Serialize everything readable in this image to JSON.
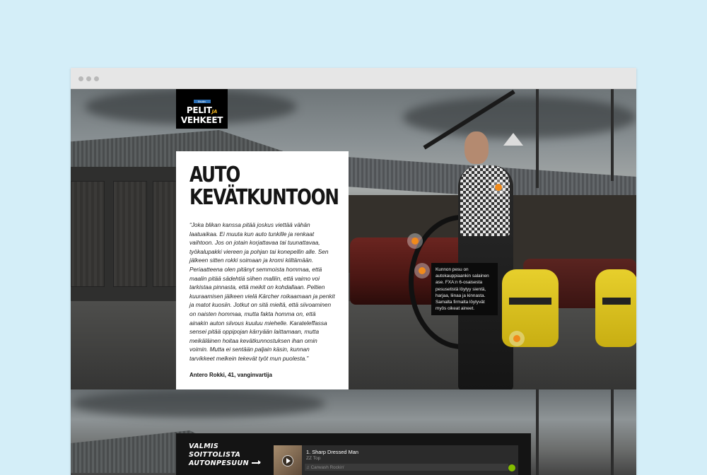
{
  "logo": {
    "badge": "fixutin",
    "line1": "PELIT",
    "line1_small": "JA",
    "line2": "VEHKEET"
  },
  "article": {
    "title_line1": "AUTO",
    "title_line2": "KEVÄTKUNTOON",
    "quote": "“Joka blikan kanssa pitää joskus viettää vähän laatuaikaa. Ei muuta kun auto tunkille ja renkaat vaihtoon. Jos on jotain korjattavaa tai tuunattavaa, työkalupakki viereen ja pohjan tai konepellin alle. Sen jälkeen sitten rokki soimaan ja kromi kiiltämään. Periaatteena olen pitänyt semmoista hommaa, että maalin pitää sädehtiä siihen malliin, että vaimo voi tarkistaa pinnasta, että meikit on kohdallaan. Peltien kuuraamisen jälkeen vielä Kärcher roikaamaan ja penkit ja matot kuosiin. Jotkut on sitä mieltä, että siivoaminen on naisten hommaa, mutta fakta homma on, että ainakin auton siivous kuuluu miehelle. Karateleffassa sensei pitää oppipojan kärryään laittamaan, mutta meikäläinen hoitaa kevätkunnostuksen ihan omin voimin. Mutta ei sentään paljain käsin, kunnan tarvikkeet melkein tekevät työt mun puolesta.”",
    "author": "Antero Rokki, 41, vanginvartija"
  },
  "tooltip": {
    "text": "Kunnon pesu on autokauppiaankin salainen ase. FXA:n 6-osaisesta pesusetistä löytyy sientä, harjaa, liinaa ja kinnasta. Samalta firmalta löytyvät myös oikeat aineet."
  },
  "playlist": {
    "title_line1": "VALMIS",
    "title_line2": "SOITTOLISTA",
    "title_line3": "AUTONPESUUN",
    "track": "1. Sharp Dressed Man",
    "artist": "ZZ Top",
    "next_track": "♫ Carwash Rockin'"
  },
  "icons": {
    "browser_dots": "window-dots-icon",
    "hotspot": "hotspot-icon",
    "play": "play-icon",
    "spotify": "spotify-icon"
  },
  "colors": {
    "background": "#d4eef8",
    "hotspot": "#f08a1b",
    "logo_accent": "#f0b422",
    "spotify": "#84bd00"
  }
}
